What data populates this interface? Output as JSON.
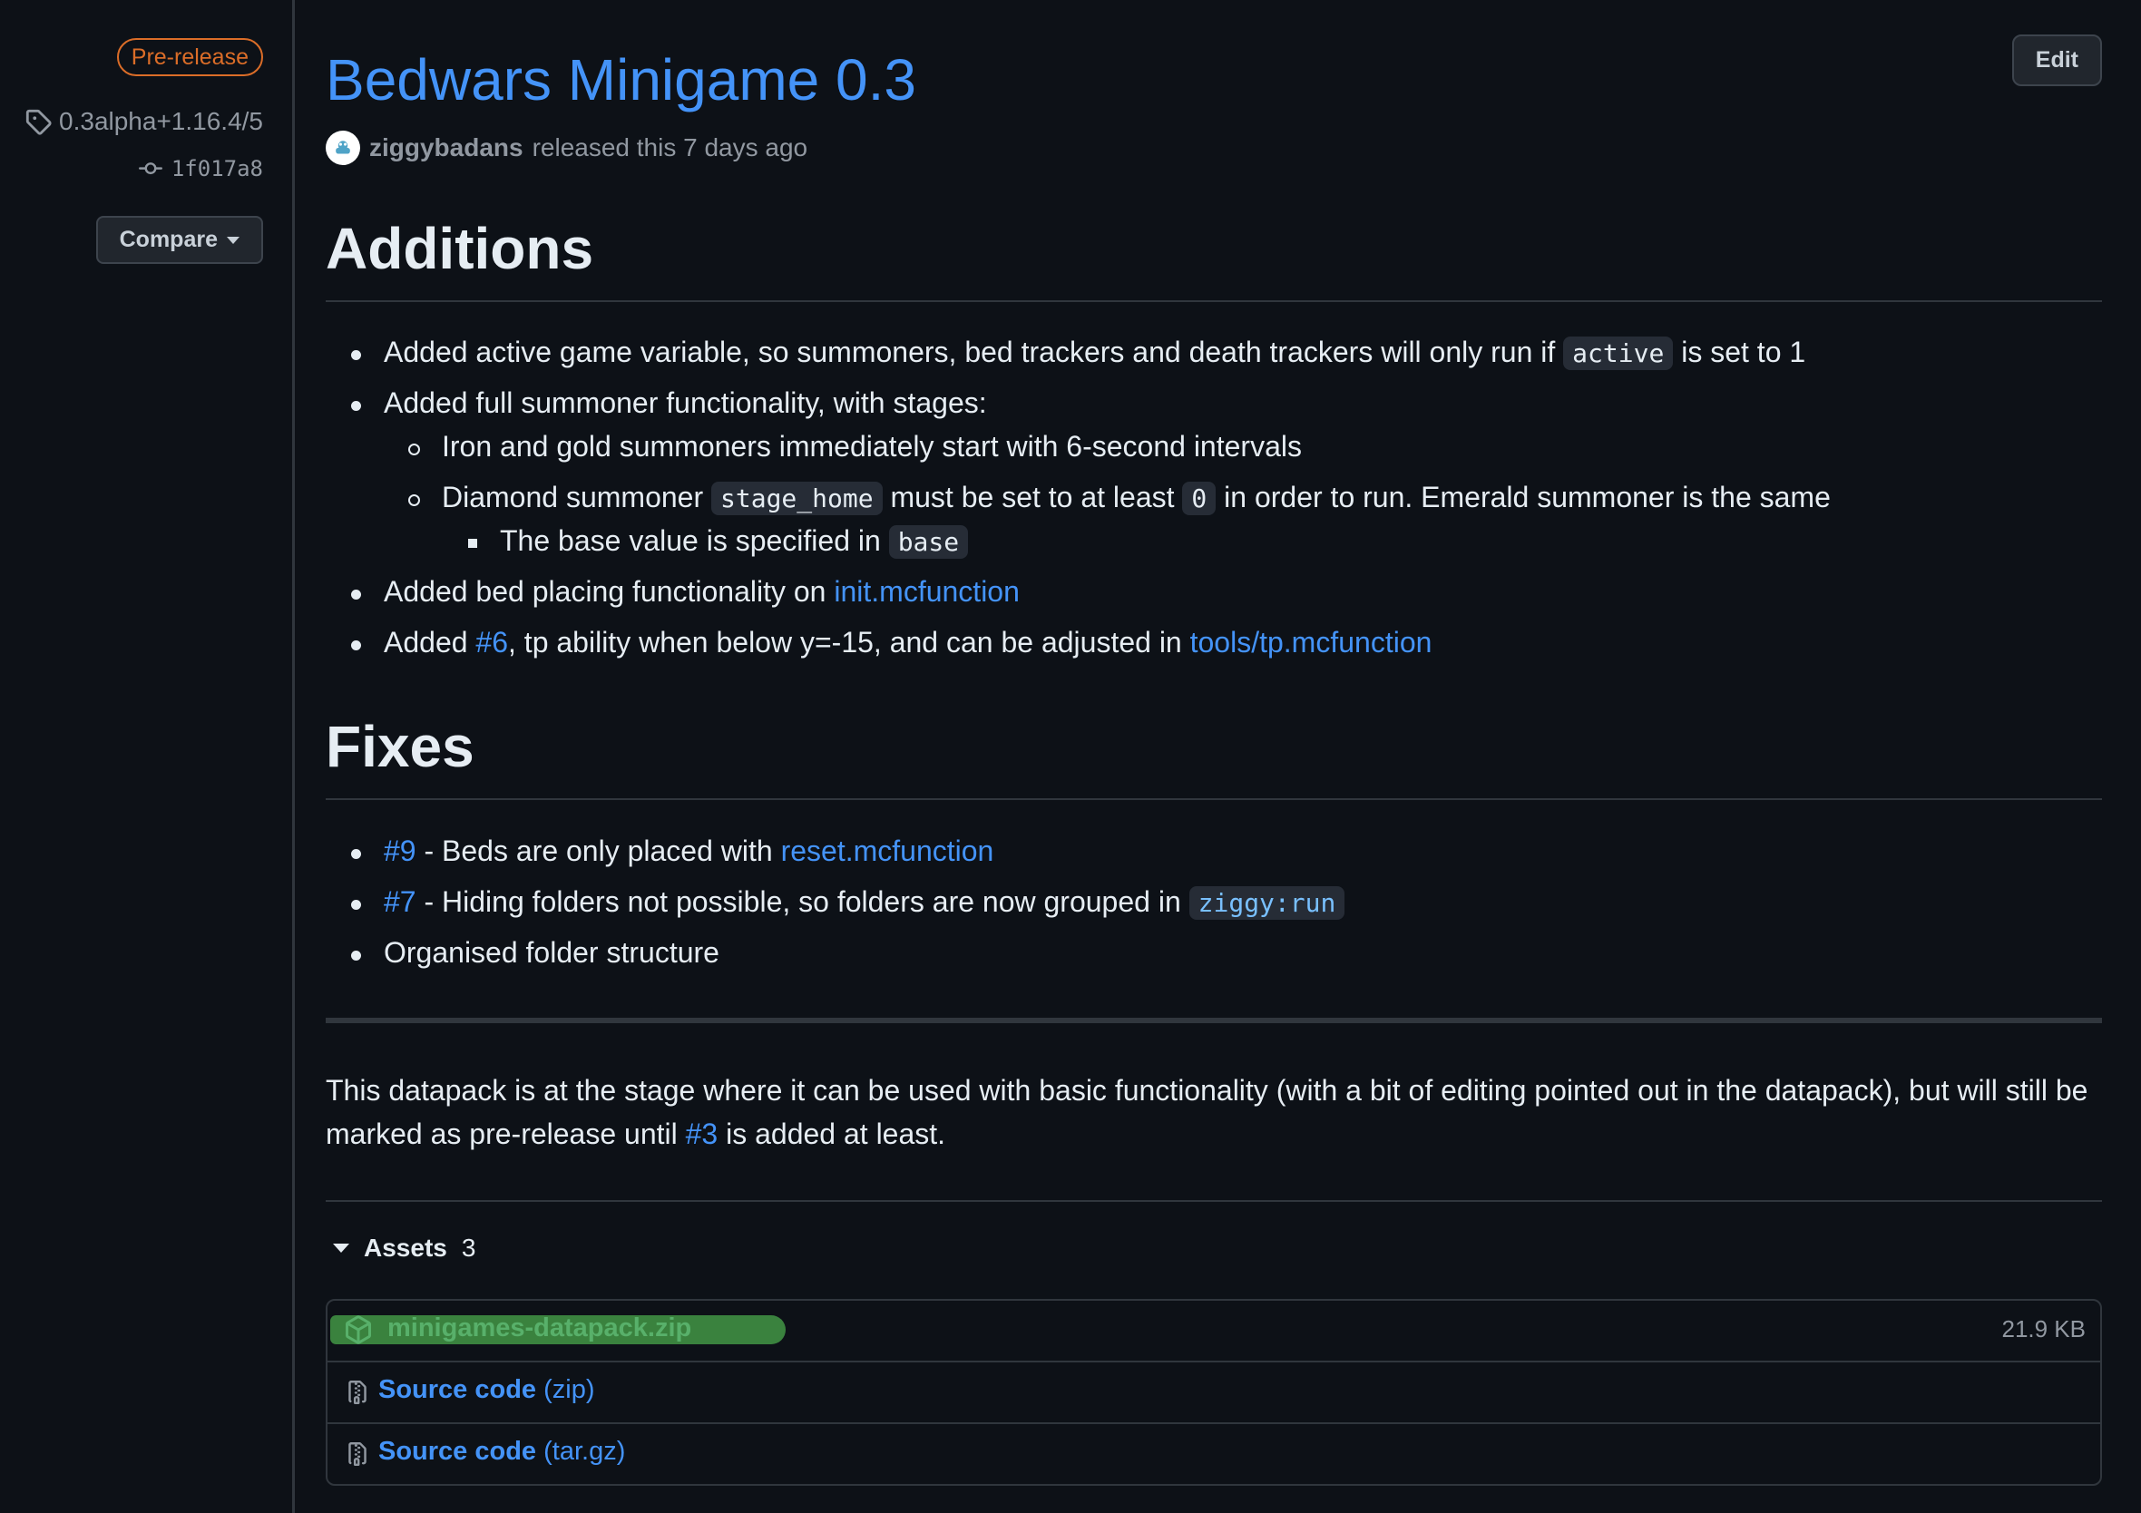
{
  "sidebar": {
    "badge": "Pre-release",
    "tag": "0.3alpha+1.16.4/5",
    "commit": "1f017a8",
    "compare_label": "Compare"
  },
  "header": {
    "title": "Bedwars Minigame 0.3",
    "edit_label": "Edit",
    "author": "ziggybadans",
    "released_text": "released this 7 days ago"
  },
  "additions": {
    "heading": "Additions",
    "item1_pre": "Added active game variable, so summoners, bed trackers and death trackers will only run if ",
    "item1_code": "active",
    "item1_post": " is set to 1",
    "item2": "Added full summoner functionality, with stages:",
    "sub1": "Iron and gold summoners immediately start with 6-second intervals",
    "sub2_pre": "Diamond summoner ",
    "sub2_code1": "stage_home",
    "sub2_mid": " must be set to at least ",
    "sub2_code2": "0",
    "sub2_post": " in order to run. Emerald summoner is the same",
    "subsub_pre": "The base value is specified in ",
    "subsub_code": "base",
    "item3_pre": "Added bed placing functionality on ",
    "item3_link": "init.mcfunction",
    "item4_pre": "Added ",
    "item4_link1": "#6",
    "item4_mid": ", tp ability when below y=-15, and can be adjusted in ",
    "item4_link2": "tools/tp.mcfunction"
  },
  "fixes": {
    "heading": "Fixes",
    "fix1_link": "#9",
    "fix1_mid": " - Beds are only placed with ",
    "fix1_link2": "reset.mcfunction",
    "fix2_link": "#7",
    "fix2_mid": " - Hiding folders not possible, so folders are now grouped in ",
    "fix2_code": "ziggy:run",
    "fix3": "Organised folder structure"
  },
  "note": {
    "pre": "This datapack is at the stage where it can be used with basic functionality (with a bit of editing pointed out in the datapack), but will still be marked as pre-release until ",
    "link": "#3",
    "post": " is added at least."
  },
  "assets": {
    "label": "Assets",
    "count": "3",
    "items": [
      {
        "name": "minigames-datapack.zip",
        "size": "21.9 KB"
      },
      {
        "name": "Source code",
        "ext": "(zip)"
      },
      {
        "name": "Source code",
        "ext": "(tar.gz)"
      }
    ]
  },
  "colors": {
    "background": "#0d1117",
    "link": "#4493f8",
    "prerelease": "#db6d28"
  }
}
